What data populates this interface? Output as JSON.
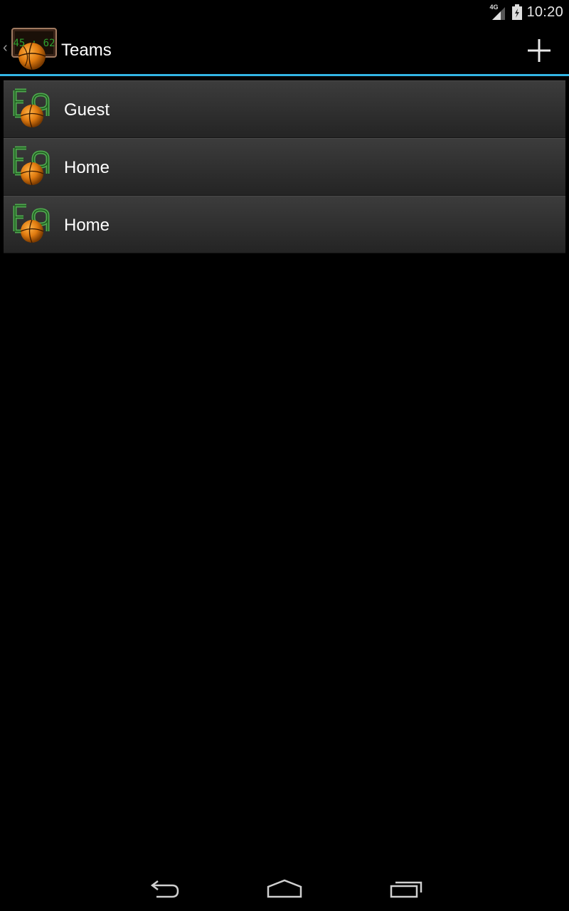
{
  "status_bar": {
    "network_type": "4G",
    "time": "10:20",
    "icons": [
      "signal-icon",
      "battery-icon"
    ]
  },
  "action_bar": {
    "scoreboard_text": "45 : 62",
    "title": "Teams",
    "add_icon": "plus-icon"
  },
  "teams": [
    {
      "name": "Guest",
      "icon": "team-logo-icon"
    },
    {
      "name": "Home",
      "icon": "team-logo-icon"
    },
    {
      "name": "Home",
      "icon": "team-logo-icon"
    }
  ],
  "nav_bar": {
    "icons": [
      "back-icon",
      "home-icon",
      "recents-icon"
    ]
  },
  "colors": {
    "accent": "#33b5e5",
    "background": "#000000",
    "row_top": "#3c3c3c",
    "row_bottom": "#242424"
  }
}
